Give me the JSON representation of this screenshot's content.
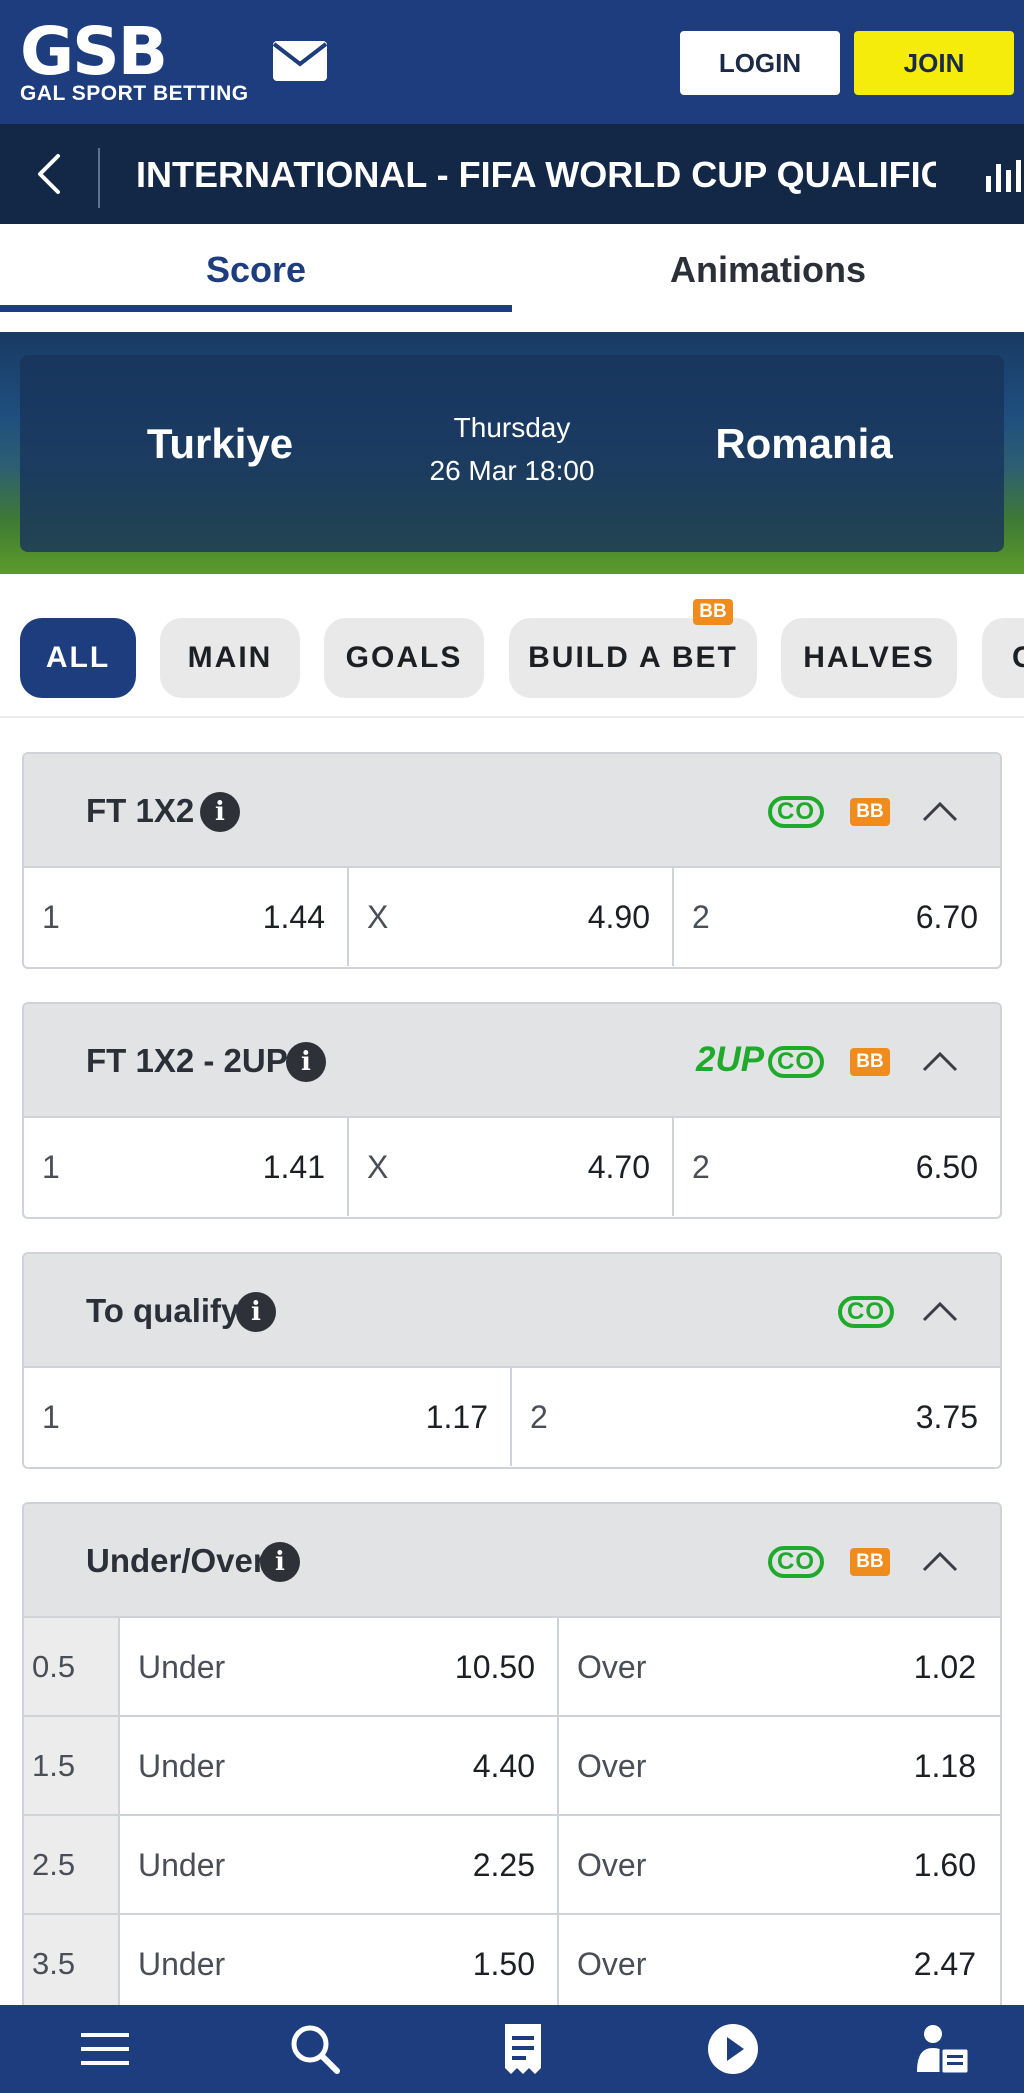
{
  "header": {
    "logo_main": "GSB",
    "logo_sub": "GAL SPORT BETTING",
    "login_label": "LOGIN",
    "join_label": "JOIN"
  },
  "event": {
    "title": "INTERNATIONAL - FIFA WORLD CUP QUALIFICATI..."
  },
  "tabs": [
    {
      "label": "Score",
      "active": true
    },
    {
      "label": "Animations",
      "active": false
    }
  ],
  "match": {
    "home": "Turkiye",
    "away": "Romania",
    "day": "Thursday",
    "datetime": "26 Mar 18:00"
  },
  "filters": [
    {
      "label": "ALL",
      "active": true
    },
    {
      "label": "MAIN",
      "active": false
    },
    {
      "label": "GOALS",
      "active": false
    },
    {
      "label": "BUILD A BET",
      "active": false,
      "badge": "BB"
    },
    {
      "label": "HALVES",
      "active": false
    },
    {
      "label": "C",
      "active": false
    }
  ],
  "markets": [
    {
      "title": "FT 1X2",
      "badges": {
        "co": "CO",
        "bb": "BB"
      },
      "odds": [
        {
          "label": "1",
          "value": "1.44"
        },
        {
          "label": "X",
          "value": "4.90"
        },
        {
          "label": "2",
          "value": "6.70"
        }
      ]
    },
    {
      "title": "FT 1X2 - 2UP",
      "badges": {
        "twoup": "2UP",
        "co": "CO",
        "bb": "BB"
      },
      "odds": [
        {
          "label": "1",
          "value": "1.41"
        },
        {
          "label": "X",
          "value": "4.70"
        },
        {
          "label": "2",
          "value": "6.50"
        }
      ]
    },
    {
      "title": "To qualify",
      "badges": {
        "co": "CO"
      },
      "odds": [
        {
          "label": "1",
          "value": "1.17"
        },
        {
          "label": "2",
          "value": "3.75"
        }
      ]
    },
    {
      "title": "Under/Over",
      "badges": {
        "co": "CO",
        "bb": "BB"
      },
      "rows": [
        {
          "line": "0.5",
          "under_label": "Under",
          "under": "10.50",
          "over_label": "Over",
          "over": "1.02"
        },
        {
          "line": "1.5",
          "under_label": "Under",
          "under": "4.40",
          "over_label": "Over",
          "over": "1.18"
        },
        {
          "line": "2.5",
          "under_label": "Under",
          "under": "2.25",
          "over_label": "Over",
          "over": "1.60"
        },
        {
          "line": "3.5",
          "under_label": "Under",
          "under": "1.50",
          "over_label": "Over",
          "over": "2.47"
        }
      ]
    }
  ],
  "bottom_nav": [
    {
      "icon": "menu-icon"
    },
    {
      "icon": "search-icon"
    },
    {
      "icon": "betslip-icon"
    },
    {
      "icon": "play-icon"
    },
    {
      "icon": "account-icon"
    }
  ],
  "colors": {
    "brand_blue": "#1d3d7e",
    "dark_navy": "#132746",
    "join_yellow": "#f5ec0b",
    "co_green": "#1faa2c",
    "bb_orange": "#f08c1e"
  }
}
